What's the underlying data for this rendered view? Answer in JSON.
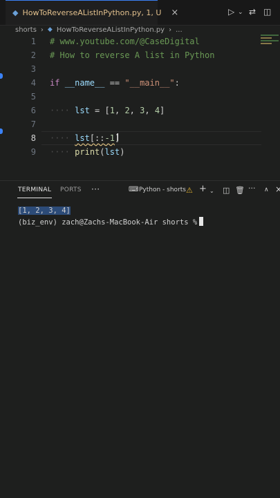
{
  "tab": {
    "filename": "HowToReverseAListInPython.py",
    "status": "1, U",
    "close": "×"
  },
  "breadcrumb": {
    "folder": "shorts",
    "separator1": "›",
    "file": "HowToReverseAListInPython.py",
    "separator2": "›",
    "more": "..."
  },
  "editor": {
    "active_line": 8,
    "lines": [
      {
        "n": "1",
        "text": "# www.youtube.com/@CaseDigital"
      },
      {
        "n": "2",
        "text": "# How to reverse A list in Python"
      },
      {
        "n": "3",
        "text": ""
      },
      {
        "n": "4",
        "kw": "if",
        "name": "__name__",
        "op": " == ",
        "str": "\"__main__\"",
        "end": ":"
      },
      {
        "n": "5",
        "text": ""
      },
      {
        "n": "6",
        "dots": "····",
        "var": "lst",
        "eq": " = ",
        "open": "[",
        "n1": "1",
        "c1": ", ",
        "n2": "2",
        "c2": ", ",
        "n3": "3",
        "c3": ", ",
        "n4": "4",
        "close": "]"
      },
      {
        "n": "7",
        "text": ""
      },
      {
        "n": "8",
        "dots": "····",
        "var": "lst",
        "rest": "[::",
        "neg": "-1",
        "close": "]"
      },
      {
        "n": "9",
        "dots": "····",
        "fn": "print",
        "open": "(",
        "var": "lst",
        "close": ")"
      }
    ]
  },
  "panel": {
    "tabs": [
      "TERMINAL",
      "PORTS",
      "···"
    ],
    "active_tab": "TERMINAL",
    "terminal_name": "Python - shorts"
  },
  "terminal": {
    "output": "[1, 2, 3, 4]",
    "prompt": "(biz_env) zach@Zachs-MacBook-Air shorts %"
  },
  "colors": {
    "accent": "#3b82f6",
    "comment": "#6a9955",
    "keyword": "#c586c0",
    "string": "#ce9178",
    "number": "#b5cea8",
    "function": "#dcdcaa",
    "variable": "#9cdcfe",
    "modified_tab": "#e2c08d",
    "selection": "#2c4b78"
  },
  "icons": {
    "tab_file": "python-file-icon",
    "run": "play-icon",
    "compare": "git-compare-icon",
    "split": "split-editor-icon",
    "terminal": "terminal-icon",
    "warning": "warning-icon",
    "add": "plus-icon",
    "trash": "trash-icon",
    "maximize": "chevron-up-icon",
    "close": "close-icon"
  }
}
